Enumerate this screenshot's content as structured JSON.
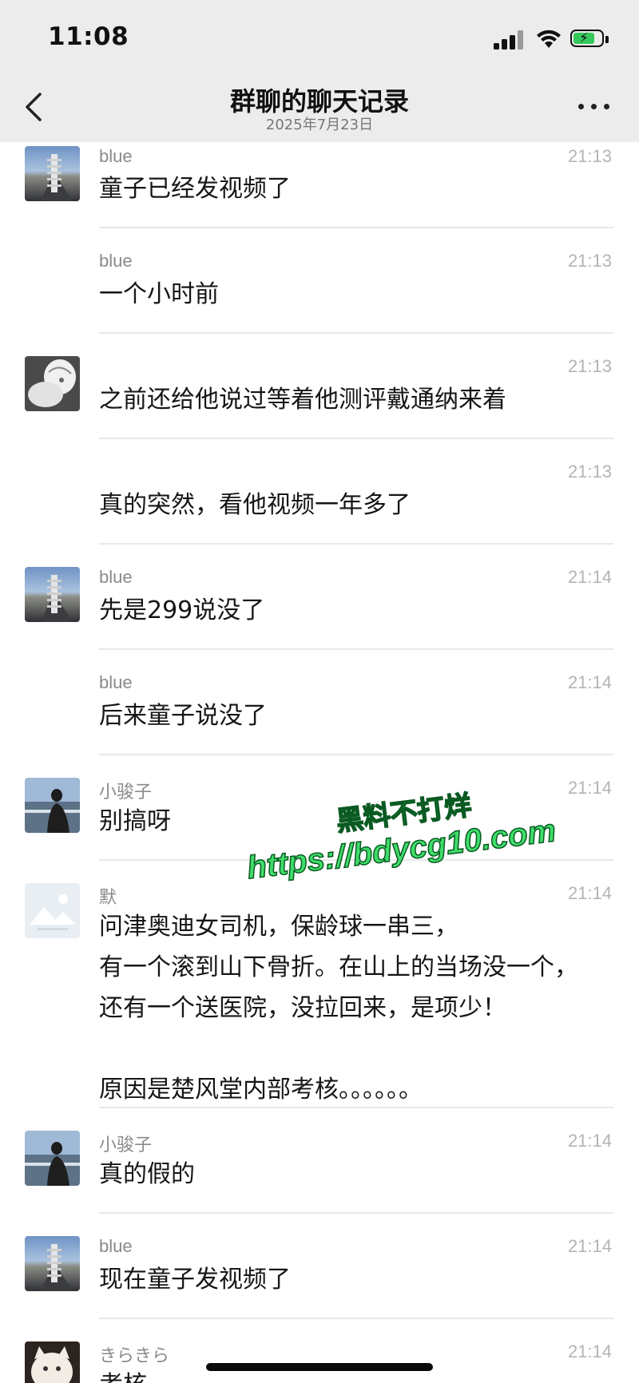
{
  "status": {
    "time": "11:08"
  },
  "header": {
    "title": "群聊的聊天记录",
    "subtitle": "2025年7月23日"
  },
  "messages": [
    {
      "sender": "blue",
      "time": "21:13",
      "text": "童子已经发视频了",
      "avatar": "road-skeleton-avatar"
    },
    {
      "sender": "blue",
      "time": "21:13",
      "text": "一个小时前",
      "avatar": ""
    },
    {
      "sender": "",
      "time": "21:13",
      "text": "之前还给他说过等着他测评戴通纳来着",
      "avatar": "sketch-figure-avatar"
    },
    {
      "sender": "",
      "time": "21:13",
      "text": "真的突然，看他视频一年多了",
      "avatar": ""
    },
    {
      "sender": "blue",
      "time": "21:14",
      "text": "先是299说没了",
      "avatar": "road-skeleton-avatar"
    },
    {
      "sender": "blue",
      "time": "21:14",
      "text": "后来童子说没了",
      "avatar": ""
    },
    {
      "sender": "小骏子",
      "time": "21:14",
      "text": "别搞呀",
      "avatar": "seaside-person-avatar"
    },
    {
      "sender": "默",
      "time": "21:14",
      "text": "问津奥迪女司机，保龄球一串三，\n有一个滚到山下骨折。在山上的当场没一个，\n还有一个送医院，没拉回来，是项少！\n\n原因是楚风堂内部考核。。。。。。",
      "avatar": "default-image-avatar"
    },
    {
      "sender": "小骏子",
      "time": "21:14",
      "text": "真的假的",
      "avatar": "seaside-person-avatar"
    },
    {
      "sender": "blue",
      "time": "21:14",
      "text": "现在童子发视频了",
      "avatar": "road-skeleton-avatar"
    },
    {
      "sender": "きらきら",
      "time": "21:14",
      "text": "考核",
      "avatar": "cat-avatar"
    }
  ],
  "watermark": {
    "line1": "黑料不打烊",
    "line2": "https://bdycg10.com"
  },
  "colors": {
    "header_bg": "#ececec",
    "battery_green": "#34c759",
    "watermark_green": "#3fdc6a"
  }
}
